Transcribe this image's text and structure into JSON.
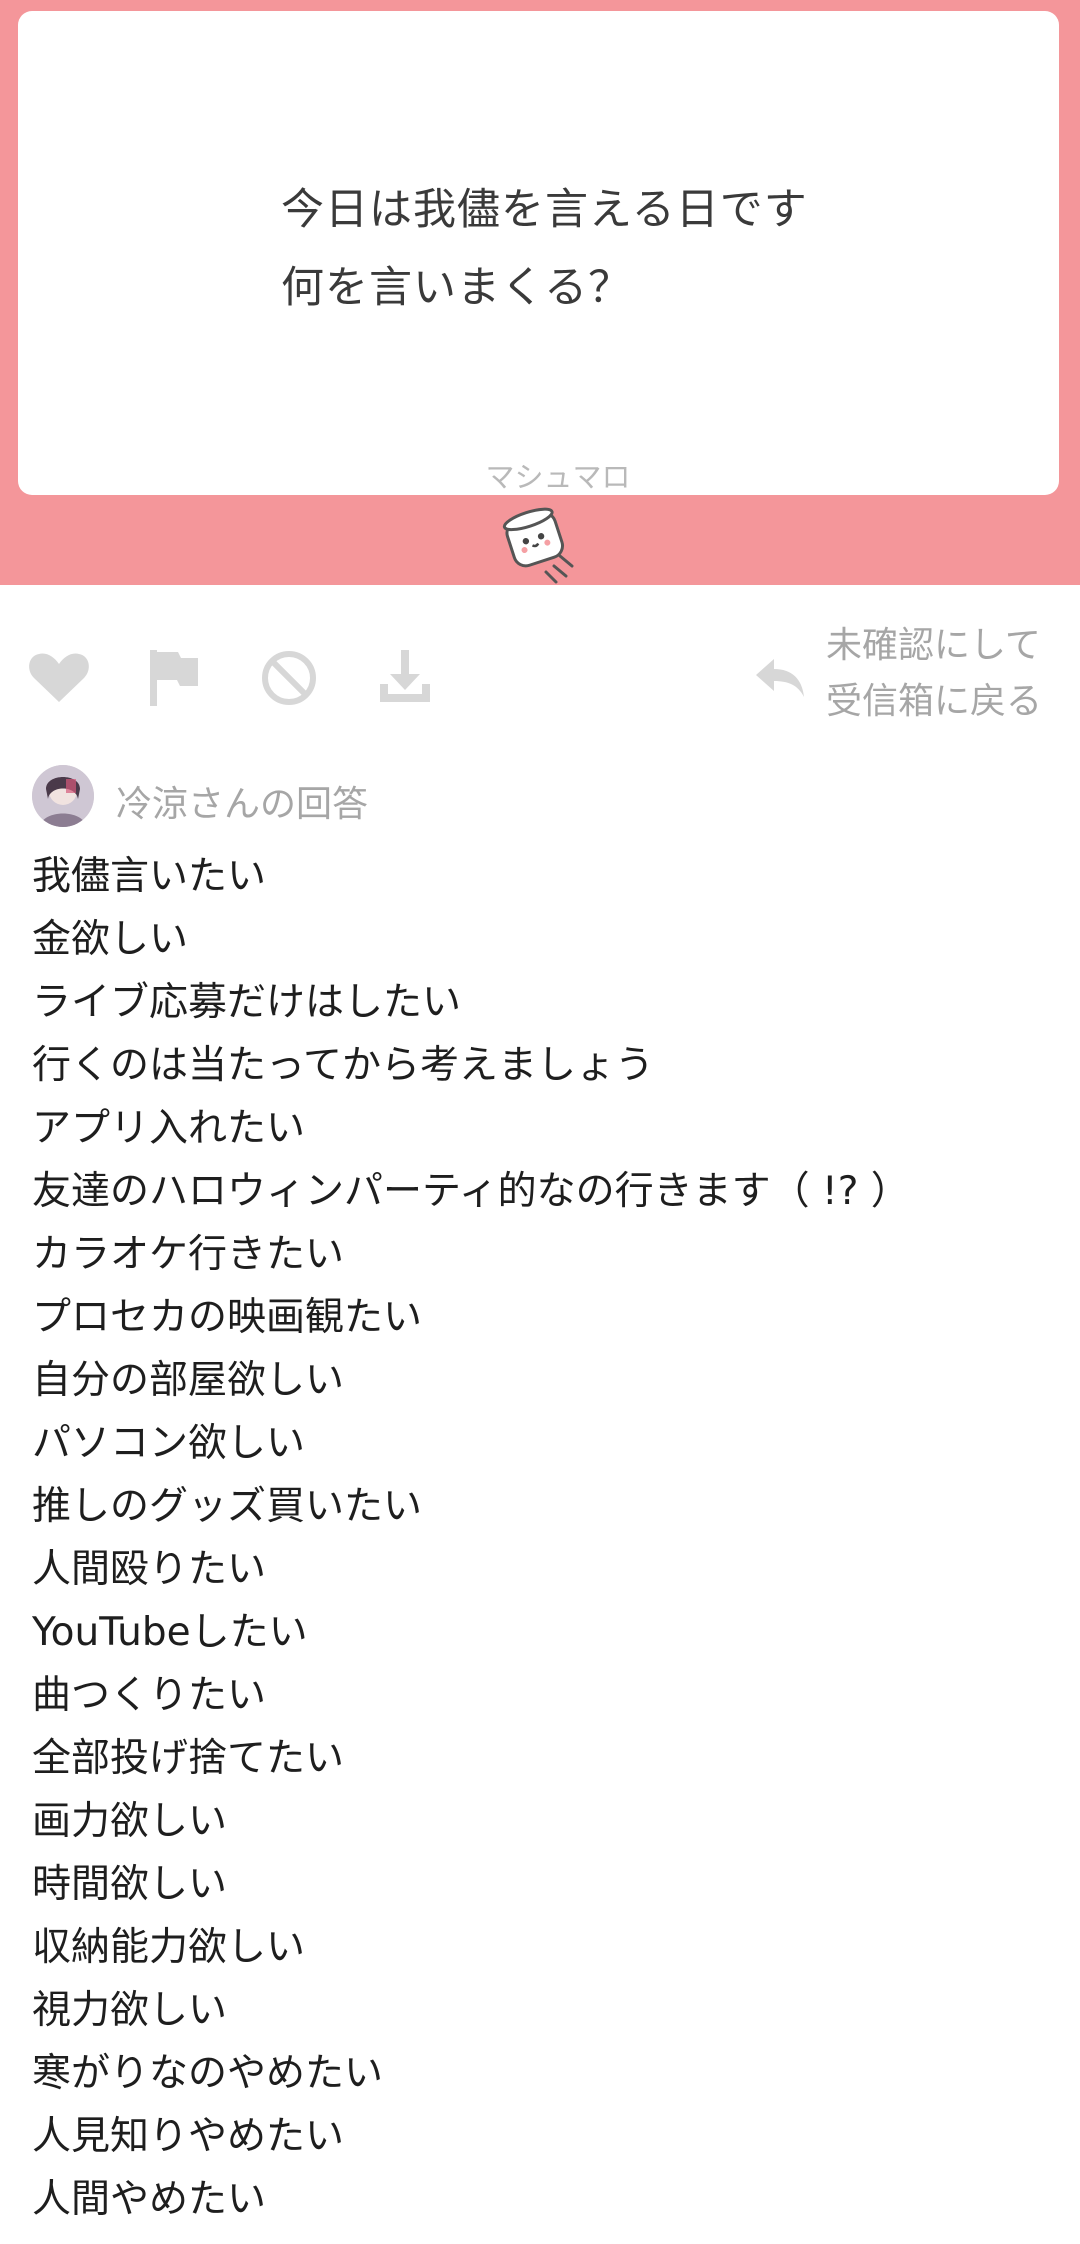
{
  "question": {
    "lines": [
      "今日は我儘を言える日です",
      "何を言いまくる？"
    ],
    "brand": "マシュマロ"
  },
  "actions": {
    "icons": [
      "heart-icon",
      "flag-icon",
      "block-icon",
      "download-icon",
      "reply-arrow-icon"
    ],
    "back_label_line1": "未確認にして",
    "back_label_line2": "受信箱に戻る"
  },
  "answer": {
    "answerer_label": "冷涼さんの回答",
    "lines": [
      "我儘言いたい",
      "金欲しい",
      "ライブ応募だけはしたい",
      "行くのは当たってから考えましょう",
      "アプリ入れたい",
      "友達のハロウィンパーティ的なの行きます（ !? ）",
      "カラオケ行きたい",
      "プロセカの映画観たい",
      "自分の部屋欲しい",
      "パソコン欲しい",
      "推しのグッズ買いたい",
      "人間殴りたい",
      "YouTubeしたい",
      "曲つくりたい",
      "全部投げ捨てたい",
      "画力欲しい",
      "時間欲しい",
      "収納能力欲しい",
      "視力欲しい",
      "寒がりなのやめたい",
      "人見知りやめたい",
      "人間やめたい"
    ]
  },
  "colors": {
    "banner": "#f4969a",
    "icon_gray": "#d7d7d7",
    "muted_text": "#a6a6a6"
  }
}
